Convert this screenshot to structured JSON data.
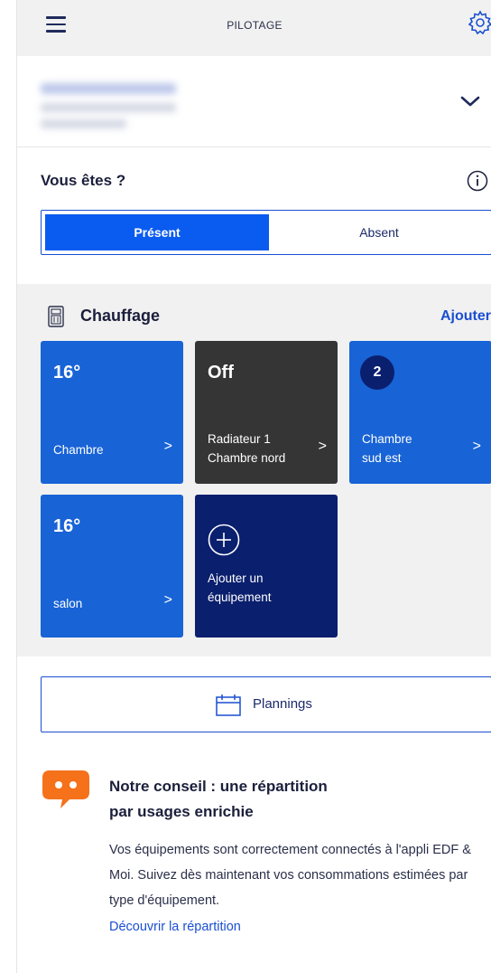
{
  "header": {
    "title": "PILOTAGE",
    "menu_icon": "hamburger-menu-icon",
    "settings_icon": "gear-icon"
  },
  "presence": {
    "question": "Vous êtes ?",
    "options": [
      "Présent",
      "Absent"
    ],
    "selected": "Présent"
  },
  "heating": {
    "title": "Chauffage",
    "add_label": "Ajouter",
    "tiles": [
      {
        "value": "16°",
        "line1": "Chambre",
        "line2": "",
        "arrow": ">"
      },
      {
        "value": "Off",
        "line1": "Radiateur 1",
        "line2": "Chambre nord",
        "arrow": ">"
      },
      {
        "value": "2",
        "line1": "Chambre",
        "line2": "sud est",
        "arrow": ">"
      },
      {
        "value": "16°",
        "line1": "salon",
        "line2": "",
        "arrow": ">"
      }
    ],
    "add_tile": {
      "line1": "Ajouter un",
      "line2": "équipement"
    }
  },
  "plannings": {
    "label": "Plannings"
  },
  "advice": {
    "title_line1": "Notre conseil : une répartition",
    "title_line2": "par usages enrichie",
    "body": "Vos équipements sont correctement connectés à l'appli EDF & Moi. Suivez dès maintenant vos consommations estimées par type d'équipement.",
    "link": "Découvrir la répartition"
  },
  "colors": {
    "primary_blue": "#0a5bf0",
    "tile_blue": "#1863d6",
    "tile_dark": "#353535",
    "tile_navy": "#0a1f6e",
    "accent_orange": "#f5711a"
  }
}
